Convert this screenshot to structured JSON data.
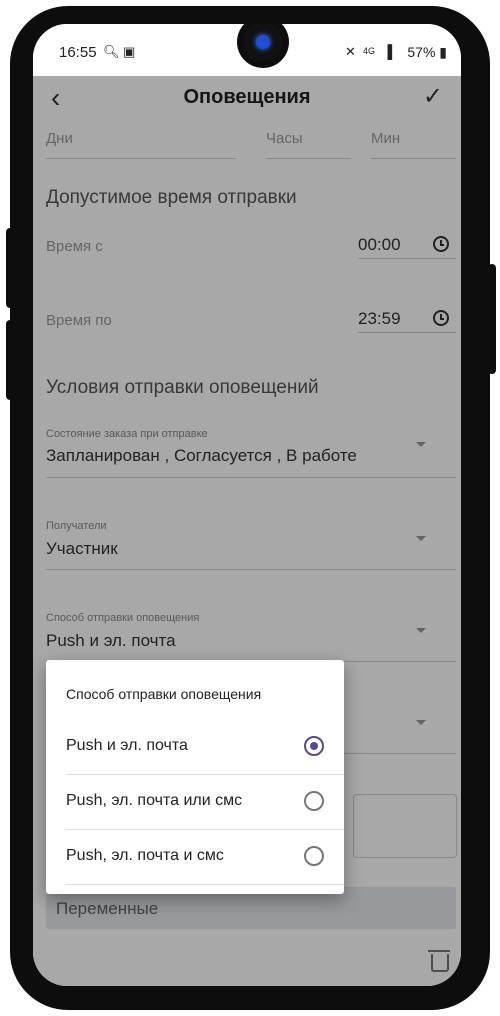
{
  "status_bar": {
    "time": "16:55",
    "indicators": "4G",
    "battery": "57%"
  },
  "app_bar": {
    "title": "Оповещения"
  },
  "form": {
    "days": "Дни",
    "hours": "Часы",
    "mins": "Мин",
    "allowed_time_section": "Допустимое время отправки",
    "time_from_label": "Время с",
    "time_from_value": "00:00",
    "time_to_label": "Время по",
    "time_to_value": "23:59",
    "conditions_section": "Условия отправки оповещений",
    "order_state_label": "Состояние заказа при отправке",
    "order_state_value": "Запланирован , Согласуется , В работе",
    "recipients_label": "Получатели",
    "recipients_value": "Участник",
    "method_label": "Способ отправки оповещения",
    "method_value": "Push и эл. почта",
    "variables_placeholder": "Переменные"
  },
  "dialog": {
    "title": "Способ отправки оповещения",
    "options": [
      "Push и эл. почта",
      "Push, эл. почта или смс",
      "Push, эл. почта и смс"
    ],
    "selected": "Push и эл. почта"
  }
}
